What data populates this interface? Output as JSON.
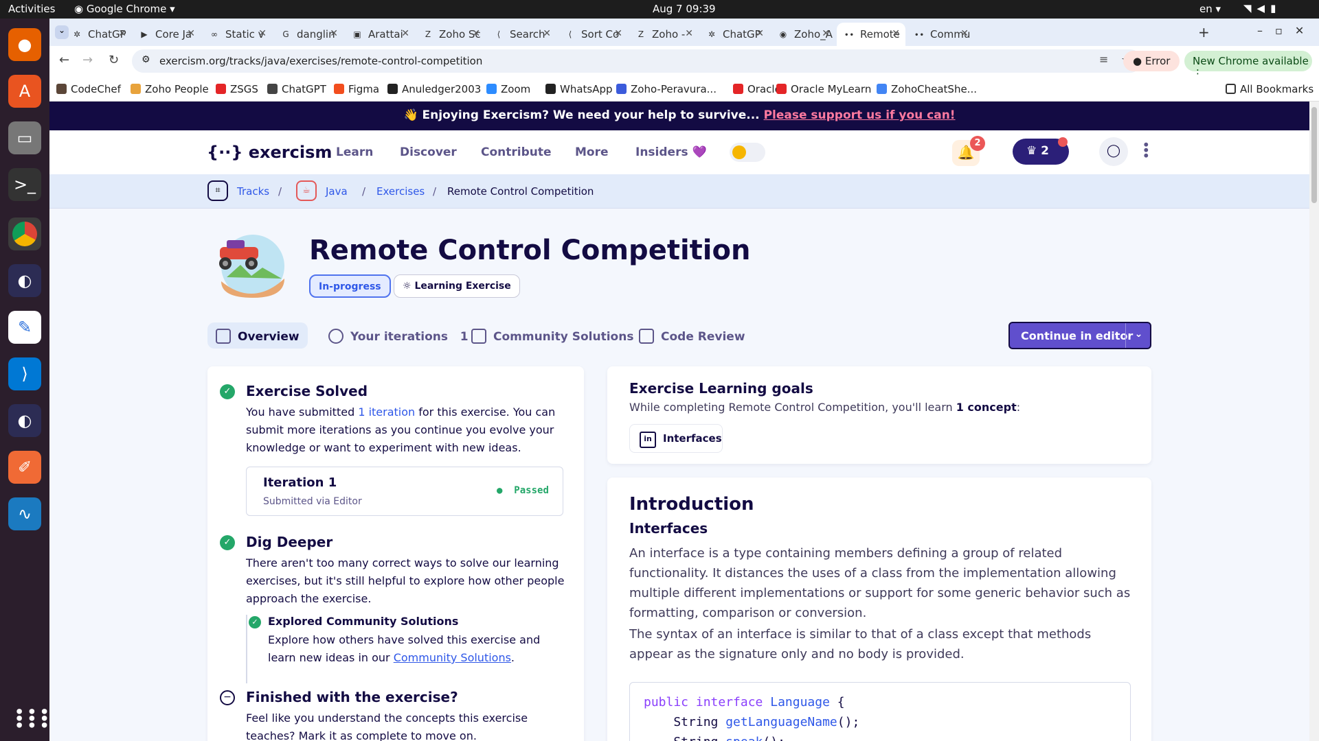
{
  "os": {
    "activities": "Activities",
    "app": "Google Chrome",
    "clock": "Aug 7  09:39",
    "lang": "en"
  },
  "tabs": [
    {
      "label": "ChatGP",
      "icon": "chatgpt-icon"
    },
    {
      "label": "Core Ja",
      "icon": "youtube-icon"
    },
    {
      "label": "Static v",
      "icon": "link-icon"
    },
    {
      "label": "danglin",
      "icon": "google-icon"
    },
    {
      "label": "Arattai",
      "icon": "arattai-icon"
    },
    {
      "label": "Zoho Sc",
      "icon": "zoho-icon"
    },
    {
      "label": "Search",
      "icon": "leetcode-icon"
    },
    {
      "label": "Sort Co",
      "icon": "leetcode-icon"
    },
    {
      "label": "Zoho -",
      "icon": "zoho-icon"
    },
    {
      "label": "ChatGP",
      "icon": "chatgpt-icon"
    },
    {
      "label": "Zoho_A",
      "icon": "github-icon"
    },
    {
      "label": "Remote",
      "icon": "exercism-icon",
      "active": true
    },
    {
      "label": "Commu",
      "icon": "exercism-icon"
    }
  ],
  "address": {
    "url": "exercism.org/tracks/java/exercises/remote-control-competition",
    "error_label": "Error",
    "update_label": "New Chrome available"
  },
  "bookmarks": [
    {
      "label": "CodeChef",
      "color": "#5b4638"
    },
    {
      "label": "Zoho People",
      "color": "#e8a33c"
    },
    {
      "label": "ZSGS",
      "color": "#e42527"
    },
    {
      "label": "ChatGPT",
      "color": "#444444"
    },
    {
      "label": "Figma",
      "color": "#f24e1e"
    },
    {
      "label": "Anuledger2003",
      "color": "#222222"
    },
    {
      "label": "Zoom",
      "color": "#2d8cff"
    },
    {
      "label": "WhatsApp",
      "color": "#222222"
    },
    {
      "label": "Zoho-Peravura...",
      "color": "#3b5bdb"
    },
    {
      "label": "Oracle",
      "color": "#e42527"
    },
    {
      "label": "Oracle MyLearn",
      "color": "#e42527"
    },
    {
      "label": "ZohoCheatShe...",
      "color": "#4285f4"
    }
  ],
  "all_bookmarks": "All Bookmarks",
  "banner": {
    "text": "👋 Enjoying Exercism? We need your help to survive...",
    "link": "Please support us if you can!"
  },
  "header": {
    "logo": "{∙∙} exercism",
    "nav": [
      "Learn",
      "Discover",
      "Contribute",
      "More",
      "Insiders 💜"
    ],
    "notifications": "2",
    "reputation": "2"
  },
  "breadcrumb": {
    "tracks": "Tracks",
    "java": "Java",
    "exercises": "Exercises",
    "current": "Remote Control Competition",
    "sep": "/"
  },
  "exercise": {
    "title": "Remote Control Competition",
    "status": "In-progress",
    "type": "Learning Exercise"
  },
  "subtabs": {
    "overview": "Overview",
    "iterations": "Your iterations",
    "iterations_count": "1",
    "community": "Community Solutions",
    "review": "Code Review",
    "continue": "Continue in editor"
  },
  "left": {
    "solved_title": "Exercise Solved",
    "solved_p1": "You have submitted ",
    "solved_link": "1 iteration",
    "solved_p2": " for this exercise. You can submit more iterations as you continue you evolve your knowledge or want to experiment with new ideas.",
    "iteration_title": "Iteration 1",
    "iteration_sub": "Submitted via Editor",
    "iteration_status": "Passed",
    "dig_title": "Dig Deeper",
    "dig_text": "There aren't too many correct ways to solve our learning exercises, but it's still helpful to explore how other people approach the exercise.",
    "explored_title": "Explored Community Solutions",
    "explored_text": "Explore how others have solved this exercise and learn new ideas in our ",
    "explored_link": "Community Solutions",
    "explored_end": ".",
    "finished_title": "Finished with the exercise?",
    "finished_text": "Feel like you understand the concepts this exercise teaches? Mark it as complete to move on."
  },
  "goals": {
    "title": "Exercise Learning goals",
    "text": "While completing Remote Control Competition, you'll learn ",
    "bold": "1 concept",
    "end": ":",
    "concept": "Interfaces"
  },
  "intro": {
    "title": "Introduction",
    "subtitle": "Interfaces",
    "p1": "An interface is a type containing members defining a group of related functionality. It distances the uses of a class from the implementation allowing multiple different implementations or support for some generic behavior such as formatting, comparison or conversion.",
    "p2": "The syntax of an interface is similar to that of a class except that methods appear as the signature only and no body is provided.",
    "code_l1_a": "public interface",
    "code_l1_b": "Language",
    "code_l1_c": " {",
    "code_l2_a": "    String ",
    "code_l2_b": "getLanguageName",
    "code_l2_c": "();",
    "code_l3_a": "    String ",
    "code_l3_b": "speak",
    "code_l3_c": "();"
  }
}
